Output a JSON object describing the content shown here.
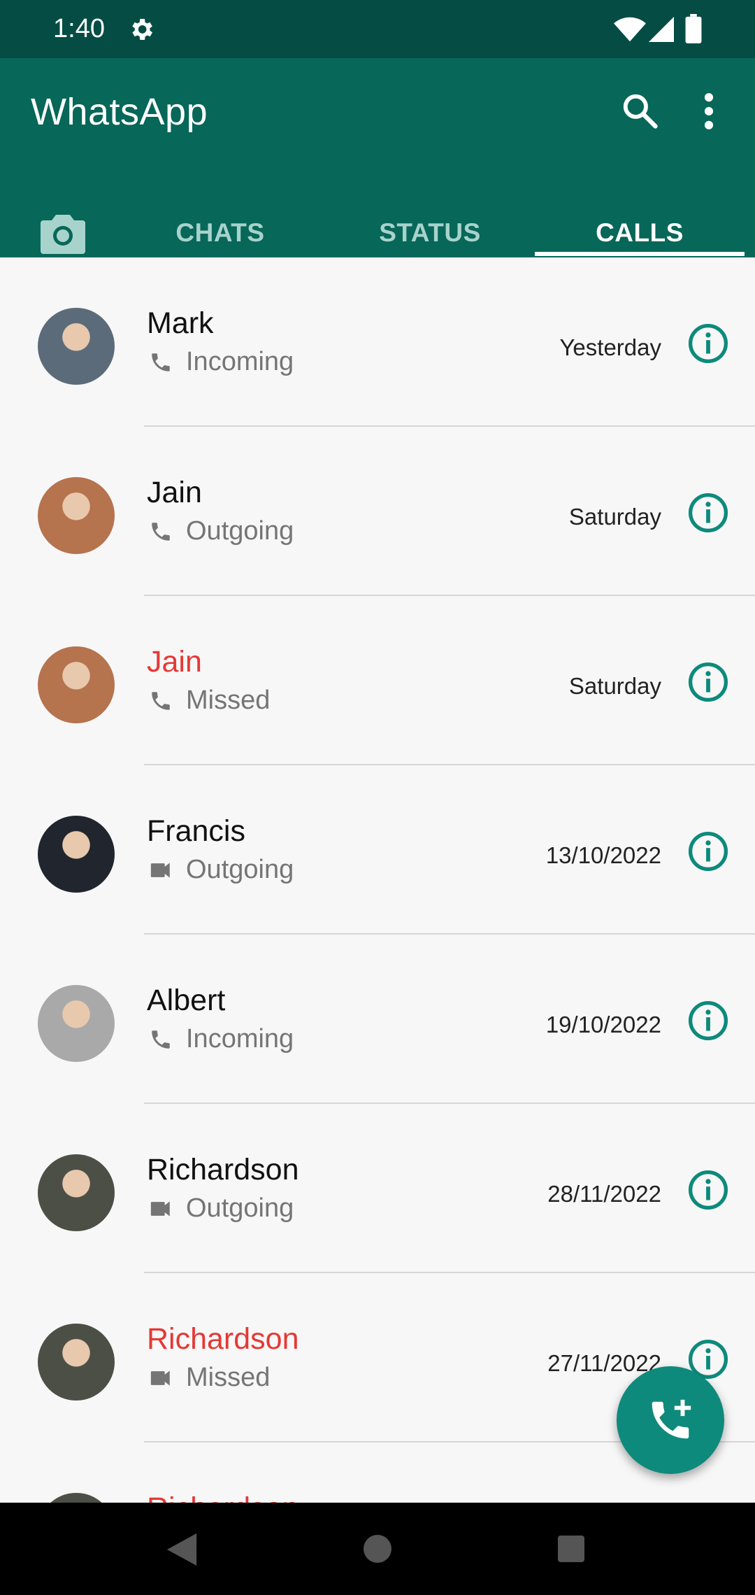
{
  "status_bar": {
    "time": "1:40",
    "icons": [
      "gear-icon",
      "wifi-icon",
      "signal-icon",
      "battery-icon"
    ]
  },
  "app_bar": {
    "title": "WhatsApp",
    "icons": [
      "search-icon",
      "more-vert-icon"
    ]
  },
  "tabs": [
    {
      "label": "",
      "icon": "camera-icon"
    },
    {
      "label": "CHATS"
    },
    {
      "label": "STATUS"
    },
    {
      "label": "CALLS",
      "selected": true
    }
  ],
  "calls": [
    {
      "name": "Mark",
      "missed": false,
      "type": "voice",
      "direction": "Incoming",
      "date": "Yesterday",
      "avatar_color": "#5b6b7a"
    },
    {
      "name": "Jain",
      "missed": false,
      "type": "voice",
      "direction": "Outgoing",
      "date": "Saturday",
      "avatar_color": "#b5734e"
    },
    {
      "name": "Jain",
      "missed": true,
      "type": "voice",
      "direction": "Missed",
      "date": "Saturday",
      "avatar_color": "#b5734e"
    },
    {
      "name": "Francis",
      "missed": false,
      "type": "video",
      "direction": "Outgoing",
      "date": "13/10/2022",
      "avatar_color": "#20252e"
    },
    {
      "name": "Albert",
      "missed": false,
      "type": "voice",
      "direction": "Incoming",
      "date": "19/10/2022",
      "avatar_color": "#a9a9a9"
    },
    {
      "name": "Richardson",
      "missed": false,
      "type": "video",
      "direction": "Outgoing",
      "date": "28/11/2022",
      "avatar_color": "#4c4f46"
    },
    {
      "name": "Richardson",
      "missed": true,
      "type": "video",
      "direction": "Missed",
      "date": "27/11/2022",
      "avatar_color": "#4c4f46"
    },
    {
      "name": "Richardson",
      "missed": true,
      "type": "video",
      "direction": "",
      "date": "",
      "avatar_color": "#4c4f46"
    }
  ],
  "fab": {
    "icon": "add-call-icon"
  },
  "colors": {
    "header": "#076759",
    "status_bar": "#054d44",
    "accent": "#0d8a7c",
    "missed": "#e53935"
  }
}
